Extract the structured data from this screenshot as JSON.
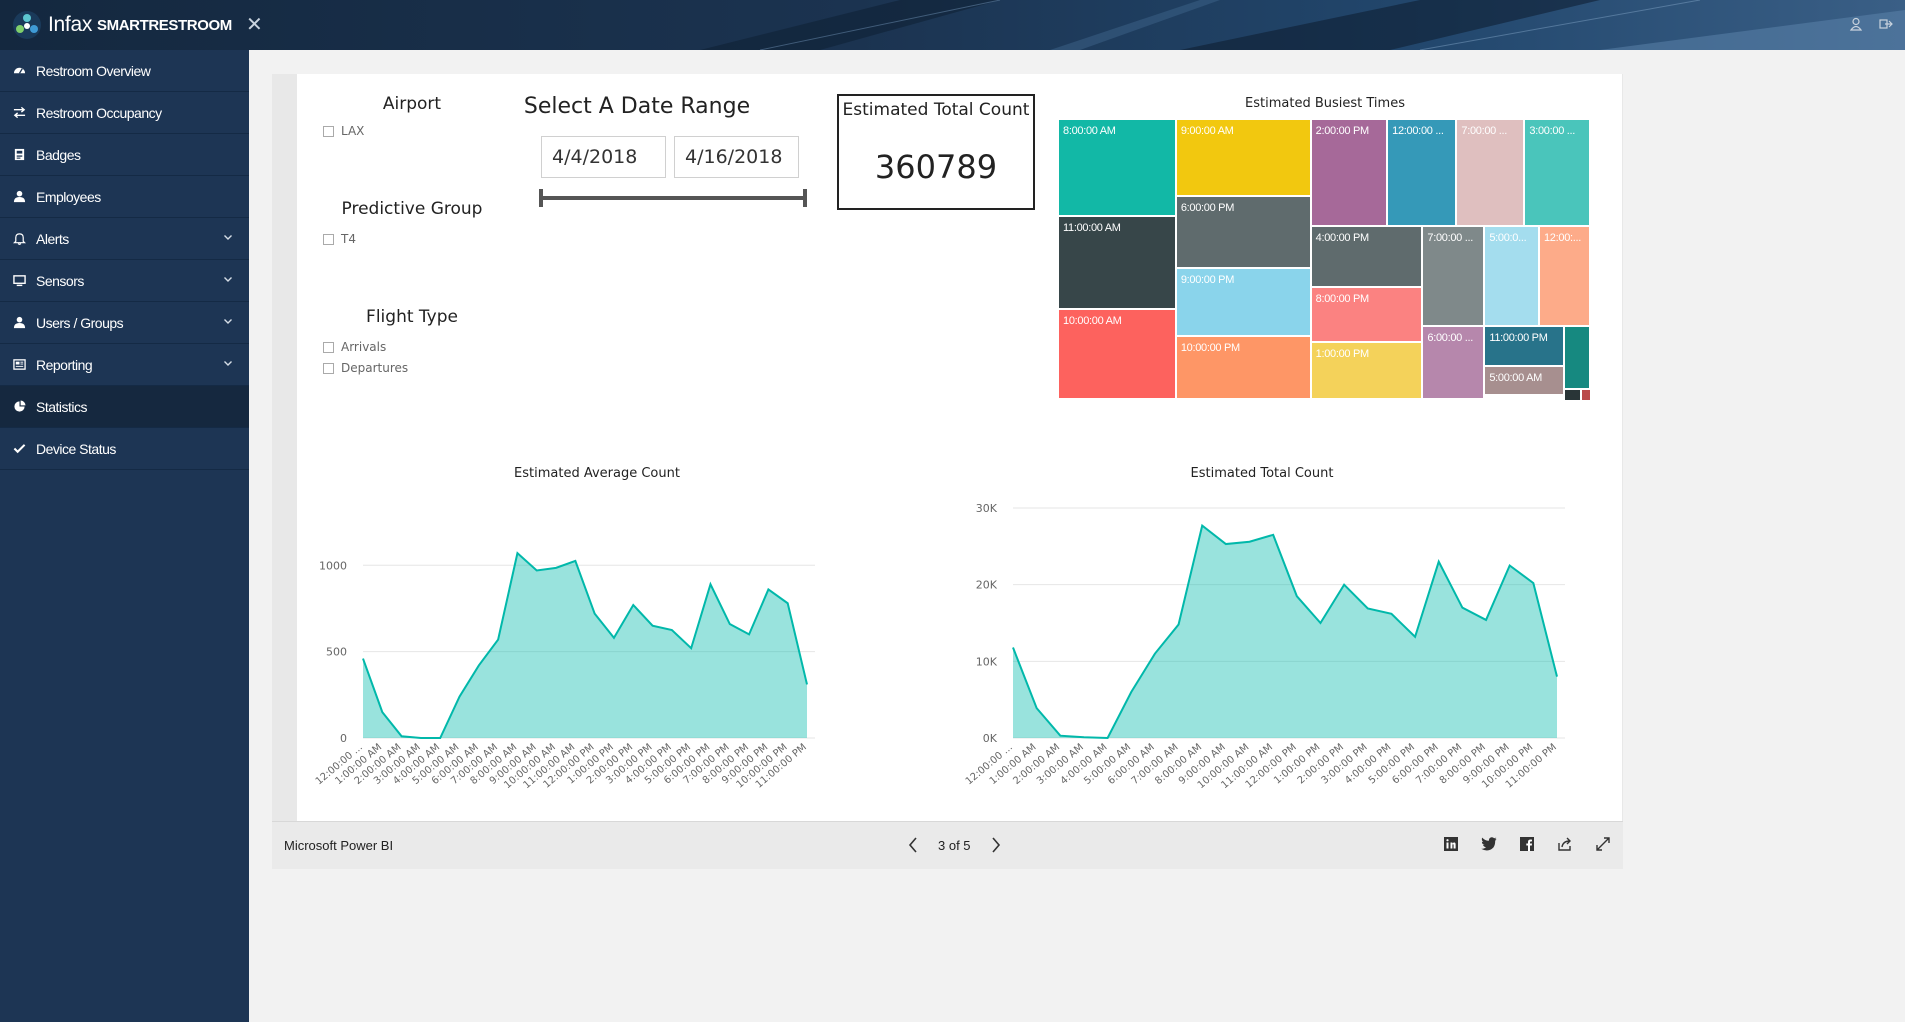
{
  "app": {
    "brand_prefix": "Infax",
    "brand_suffix": "SMARTRESTROOM",
    "close_glyph": "✕"
  },
  "sidebar": {
    "items": [
      {
        "label": "Restroom Overview",
        "icon": "dashboard-icon",
        "has_chevron": false
      },
      {
        "label": "Restroom Occupancy",
        "icon": "exchange-icon",
        "has_chevron": false
      },
      {
        "label": "Badges",
        "icon": "badge-icon",
        "has_chevron": false
      },
      {
        "label": "Employees",
        "icon": "user-icon",
        "has_chevron": false
      },
      {
        "label": "Alerts",
        "icon": "bell-icon",
        "has_chevron": true
      },
      {
        "label": "Sensors",
        "icon": "monitor-icon",
        "has_chevron": true
      },
      {
        "label": "Users / Groups",
        "icon": "user-icon",
        "has_chevron": true
      },
      {
        "label": "Reporting",
        "icon": "newspaper-icon",
        "has_chevron": true
      },
      {
        "label": "Statistics",
        "icon": "pie-chart-icon",
        "has_chevron": false,
        "active": true
      },
      {
        "label": "Device Status",
        "icon": "check-icon",
        "has_chevron": false
      }
    ]
  },
  "report": {
    "airport": {
      "title": "Airport",
      "options": [
        "LAX"
      ]
    },
    "predictive_group": {
      "title": "Predictive Group",
      "options": [
        "T4"
      ]
    },
    "flight_type": {
      "title": "Flight Type",
      "options": [
        "Arrivals",
        "Departures"
      ]
    },
    "date_range": {
      "title": "Select A Date Range",
      "start": "4/4/2018",
      "end": "4/16/2018"
    },
    "kpi": {
      "title": "Estimated Total Count",
      "value": "360789"
    },
    "treemap": {
      "title": "Estimated Busiest Times",
      "cells": [
        {
          "label": "8:00:00 AM",
          "color": "#12b8a6"
        },
        {
          "label": "11:00:00 AM",
          "color": "#374649"
        },
        {
          "label": "10:00:00 AM",
          "color": "#fd625e"
        },
        {
          "label": "9:00:00 AM",
          "color": "#f2c80f"
        },
        {
          "label": "6:00:00 PM",
          "color": "#5f6b6d"
        },
        {
          "label": "9:00:00 PM",
          "color": "#8ad4eb"
        },
        {
          "label": "10:00:00 PM",
          "color": "#fe9666"
        },
        {
          "label": "2:00:00 PM",
          "color": "#a66999"
        },
        {
          "label": "12:00:00 ...",
          "color": "#3599b8"
        },
        {
          "label": "7:00:00 ...",
          "color": "#dfbfbf"
        },
        {
          "label": "3:00:00 ...",
          "color": "#4ac5bb"
        },
        {
          "label": "4:00:00 PM",
          "color": "#5f6b6d"
        },
        {
          "label": "8:00:00 PM",
          "color": "#fb8281"
        },
        {
          "label": "1:00:00 PM",
          "color": "#f4d25a"
        },
        {
          "label": "7:00:00 ...",
          "color": "#7f898a"
        },
        {
          "label": "5:00:0...",
          "color": "#a4ddee"
        },
        {
          "label": "12:00:...",
          "color": "#fdab89"
        },
        {
          "label": "6:00:00 ...",
          "color": "#b687ac"
        },
        {
          "label": "11:00:00 PM",
          "color": "#28738a"
        },
        {
          "label": "5:00:00 AM",
          "color": "#a78f8f"
        },
        {
          "label": "",
          "color": "#168980"
        },
        {
          "label": "",
          "color": "#293537"
        },
        {
          "label": "",
          "color": "#bb4a4a"
        }
      ]
    },
    "hour_labels": [
      "12:00:00 ...",
      "1:00:00 AM",
      "2:00:00 AM",
      "3:00:00 AM",
      "4:00:00 AM",
      "5:00:00 AM",
      "6:00:00 AM",
      "7:00:00 AM",
      "8:00:00 AM",
      "9:00:00 AM",
      "10:00:00 AM",
      "11:00:00 AM",
      "12:00:00 PM",
      "1:00:00 PM",
      "2:00:00 PM",
      "3:00:00 PM",
      "4:00:00 PM",
      "5:00:00 PM",
      "6:00:00 PM",
      "7:00:00 PM",
      "8:00:00 PM",
      "9:00:00 PM",
      "10:00:00 PM",
      "11:00:00 PM"
    ],
    "page_indicator": "3 of 5",
    "footer_label": "Microsoft Power BI"
  },
  "chart_data": [
    {
      "type": "area",
      "title": "Estimated Average Count",
      "xlabel": "",
      "ylabel": "",
      "ylim": [
        0,
        1100
      ],
      "yticks": [
        "0",
        "500",
        "1000"
      ],
      "ytick_values": [
        0,
        500,
        1000
      ],
      "categories": [
        "12:00:00 ...",
        "1:00:00 AM",
        "2:00:00 AM",
        "3:00:00 AM",
        "4:00:00 AM",
        "5:00:00 AM",
        "6:00:00 AM",
        "7:00:00 AM",
        "8:00:00 AM",
        "9:00:00 AM",
        "10:00:00 AM",
        "11:00:00 AM",
        "12:00:00 PM",
        "1:00:00 PM",
        "2:00:00 PM",
        "3:00:00 PM",
        "4:00:00 PM",
        "5:00:00 PM",
        "6:00:00 PM",
        "7:00:00 PM",
        "8:00:00 PM",
        "9:00:00 PM",
        "10:00:00 PM",
        "11:00:00 PM"
      ],
      "values": [
        460,
        150,
        10,
        0,
        0,
        240,
        420,
        570,
        1070,
        970,
        985,
        1025,
        720,
        580,
        770,
        650,
        625,
        520,
        890,
        660,
        600,
        860,
        780,
        310
      ],
      "color": "#01b8aa",
      "grid": true
    },
    {
      "type": "area",
      "title": "Estimated Total Count",
      "xlabel": "",
      "ylabel": "",
      "ylim": [
        0,
        30000
      ],
      "yticks": [
        "0K",
        "10K",
        "20K",
        "30K"
      ],
      "ytick_values": [
        0,
        10000,
        20000,
        30000
      ],
      "categories": [
        "12:00:00 ...",
        "1:00:00 AM",
        "2:00:00 AM",
        "3:00:00 AM",
        "4:00:00 AM",
        "5:00:00 AM",
        "6:00:00 AM",
        "7:00:00 AM",
        "8:00:00 AM",
        "9:00:00 AM",
        "10:00:00 AM",
        "11:00:00 AM",
        "12:00:00 PM",
        "1:00:00 PM",
        "2:00:00 PM",
        "3:00:00 PM",
        "4:00:00 PM",
        "5:00:00 PM",
        "6:00:00 PM",
        "7:00:00 PM",
        "8:00:00 PM",
        "9:00:00 PM",
        "10:00:00 PM",
        "11:00:00 PM"
      ],
      "values": [
        11800,
        3900,
        300,
        100,
        0,
        6000,
        11000,
        14800,
        27700,
        25300,
        25600,
        26500,
        18500,
        15000,
        20000,
        16900,
        16200,
        13200,
        23000,
        17000,
        15400,
        22500,
        20200,
        8000
      ],
      "color": "#01b8aa",
      "grid": true
    }
  ]
}
